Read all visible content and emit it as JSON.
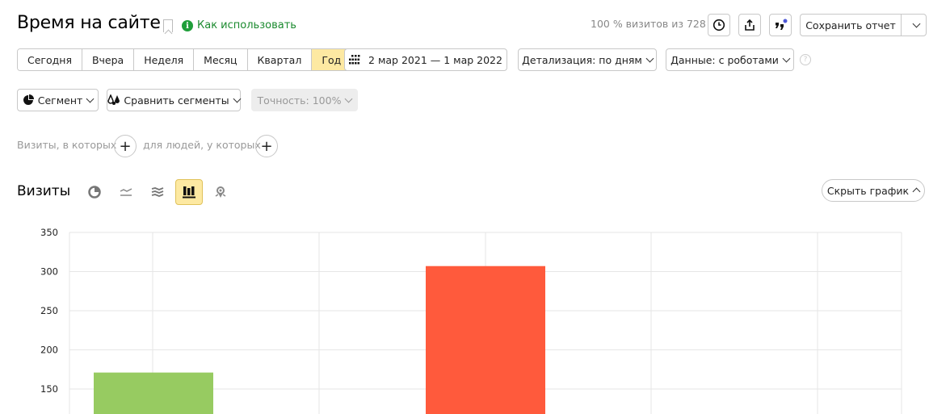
{
  "header": {
    "title": "Время на сайте",
    "howto_label": "Как использовать",
    "visits_share": "100 % визитов из 728",
    "save_label": "Сохранить отчет"
  },
  "periods": [
    {
      "label": "Сегодня",
      "active": false
    },
    {
      "label": "Вчера",
      "active": false
    },
    {
      "label": "Неделя",
      "active": false
    },
    {
      "label": "Месяц",
      "active": false
    },
    {
      "label": "Квартал",
      "active": false
    },
    {
      "label": "Год",
      "active": true
    }
  ],
  "date_range": "2 мар 2021 — 1 мар 2022",
  "detail_label": "Детализация: по дням",
  "data_label": "Данные: с роботами",
  "segment_label": "Сегмент",
  "compare_label": "Сравнить сегменты",
  "accuracy_label": "Точность: 100%",
  "conditions": {
    "visits_label": "Визиты, в которых",
    "people_label": "для людей, у которых"
  },
  "chart_section": {
    "title": "Визиты",
    "hide_label": "Скрыть график",
    "view_icons": [
      "pie-chart-icon",
      "line-chart-icon",
      "area-chart-icon",
      "bar-chart-icon",
      "map-icon"
    ],
    "active_view": "bar-chart-icon"
  },
  "colors": {
    "accent": "#fde9a2",
    "green_bar": "#97cb61",
    "red_bar": "#ff5a3c",
    "link_green": "#1a8a2e"
  },
  "chart_data": {
    "type": "bar",
    "yticks": [
      350,
      300,
      250,
      200,
      150
    ],
    "ylim": [
      115,
      350
    ],
    "grid": true,
    "bars": [
      {
        "value": 171,
        "color": "#97cb61"
      },
      {
        "value": 307,
        "color": "#ff5a3c"
      }
    ]
  }
}
